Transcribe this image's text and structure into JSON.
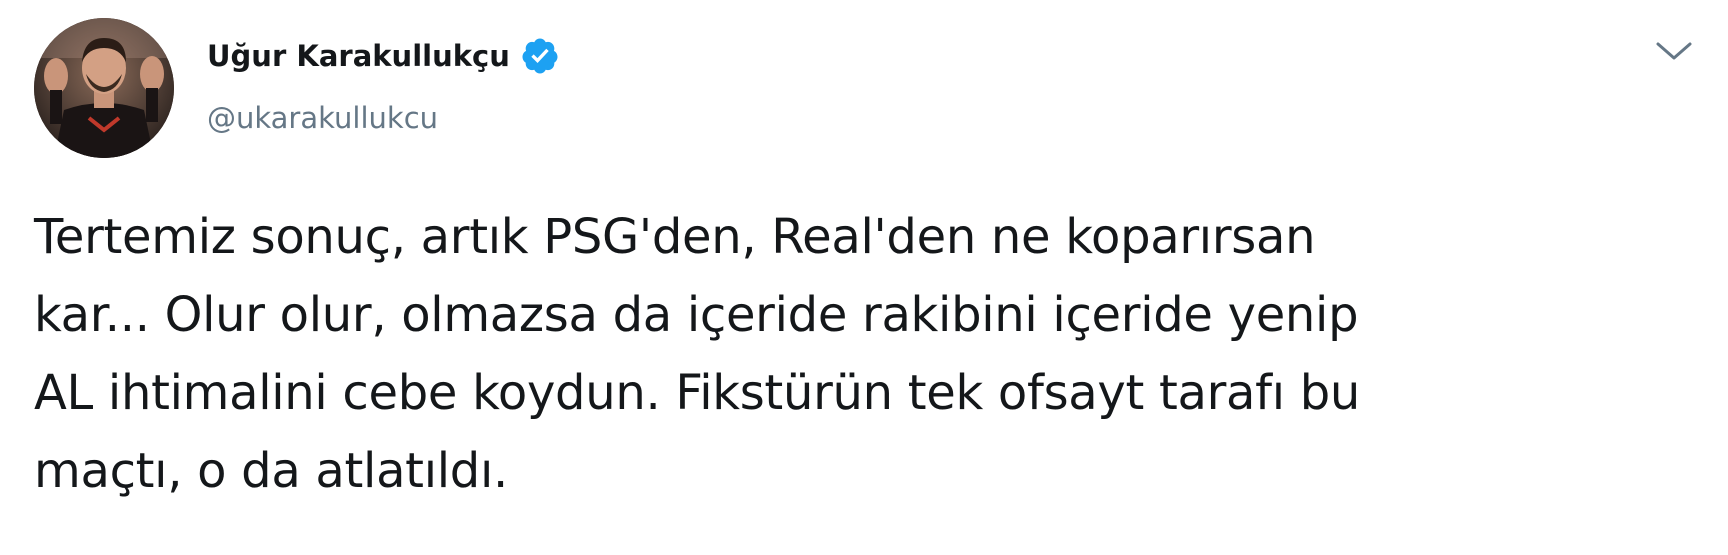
{
  "author": {
    "display_name": "Uğur Karakullukçu",
    "handle": "@ukarakullukcu",
    "verified": true,
    "avatar_icon": "profile-photo",
    "verified_icon": "verified-badge-icon",
    "verified_color": "#1da1f2"
  },
  "menu": {
    "icon": "chevron-down-icon",
    "color": "#657786"
  },
  "tweet": {
    "lines": [
      "Tertemiz sonuç, artık PSG'den, Real'den ne koparırsan",
      "kar... Olur olur, olmazsa da içeride rakibini içeride yenip",
      "AL ihtimalini cebe koydun. Fikstürün tek ofsayt tarafı bu",
      "maçtı, o da atlatıldı."
    ]
  }
}
